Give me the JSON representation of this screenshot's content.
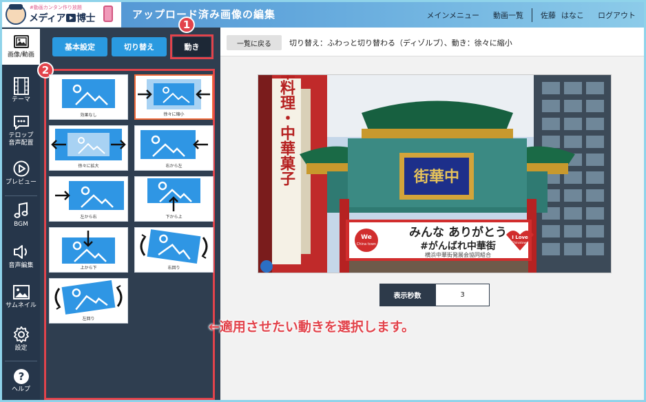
{
  "header": {
    "logo_tagline": "#動画カンタン作り放題",
    "logo_name_a": "メディア",
    "logo_name_b": "博士",
    "title": "アップロード済み画像の編集",
    "nav": [
      "メインメニュー",
      "動画一覧"
    ],
    "user_last": "佐藤",
    "user_first": "はなこ",
    "logout": "ログアウト"
  },
  "sidebar": {
    "items": [
      {
        "label": "画像/動画",
        "icon": "image-icon"
      },
      {
        "label": "テーマ",
        "icon": "film-icon"
      },
      {
        "label": "テロップ",
        "label2": "音声配置",
        "icon": "caption-icon"
      },
      {
        "label": "プレビュー",
        "icon": "play-icon"
      },
      {
        "label": "BGM",
        "icon": "music-icon"
      },
      {
        "label": "音声編集",
        "icon": "speaker-icon"
      },
      {
        "label": "サムネイル",
        "icon": "thumbnail-icon"
      },
      {
        "label": "設定",
        "icon": "gear-icon"
      },
      {
        "label": "ヘルプ",
        "icon": "help-icon"
      }
    ]
  },
  "panel": {
    "tabs": [
      "基本設定",
      "切り替え",
      "動き"
    ],
    "badge1": "1",
    "badge2": "2",
    "effects": [
      {
        "label": "効果なし",
        "selected": false
      },
      {
        "label": "徐々に縮小",
        "selected": true
      },
      {
        "label": "徐々に拡大",
        "selected": false
      },
      {
        "label": "右から左",
        "selected": false
      },
      {
        "label": "左から右",
        "selected": false
      },
      {
        "label": "下から上",
        "selected": false
      },
      {
        "label": "上から下",
        "selected": false
      },
      {
        "label": "右回り",
        "selected": false
      },
      {
        "label": "左回り",
        "selected": false
      }
    ]
  },
  "main": {
    "back_label": "一覧に戻る",
    "status": "切り替え：ふわっと切り替わる（ディゾルブ）、動き：徐々に縮小",
    "photo": {
      "gate_plaque": "街華中",
      "banner_line1": "みんな ありがとう",
      "banner_line2": "#がんばれ中華街",
      "banner_line3": "横浜中華街発展会協同組合",
      "left_sign": "高級中華料理・中華菓子",
      "sticker_left_line1": "We",
      "sticker_left_line2": "China town",
      "sticker_right_line1": "I Love",
      "sticker_right_line2": "Chinatown"
    },
    "duration_label": "表示秒数",
    "duration_value": "3",
    "annotation": "←適用させたい動きを選択します。"
  },
  "colors": {
    "accent_red": "#e2434b",
    "button_blue": "#2a9ae0",
    "sidebar_dark": "#26364a",
    "panel_dark": "#2f3e50",
    "thumb_blue": "#2f96e4"
  }
}
